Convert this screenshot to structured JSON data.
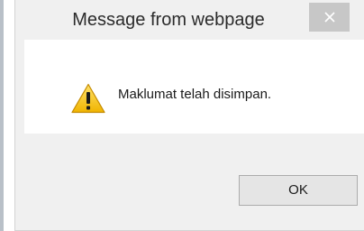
{
  "dialog": {
    "title": "Message from webpage",
    "message": "Maklumat telah disimpan.",
    "ok_label": "OK",
    "close_icon": "close-icon",
    "message_icon": "warning-icon"
  },
  "colors": {
    "dialog_background": "#f0f0f0",
    "content_background": "#ffffff",
    "close_button": "#c7c7c7",
    "warning_yellow": "#f4c21b"
  }
}
